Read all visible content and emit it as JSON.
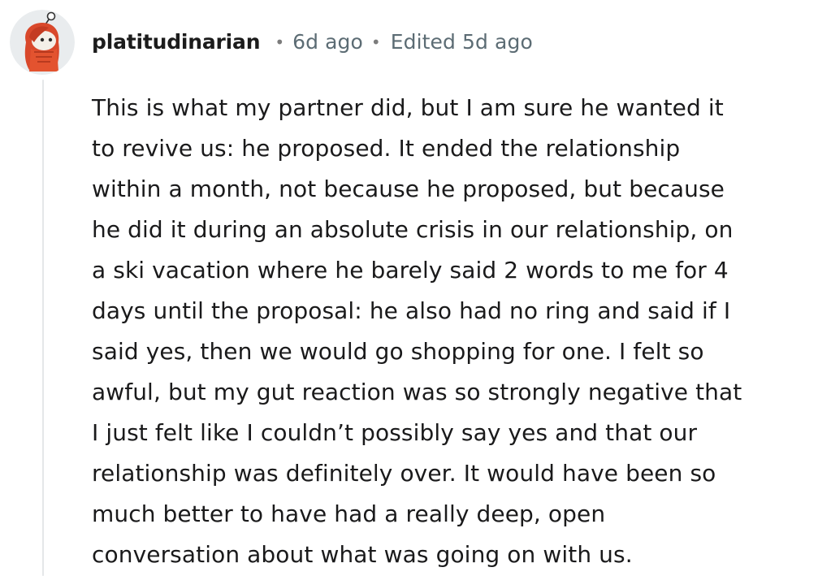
{
  "comment": {
    "author": {
      "username": "platitudinarian",
      "avatar_icon": "snoo-avatar-icon"
    },
    "separator": "•",
    "posted": "6d ago",
    "edited": "Edited 5d ago",
    "body_lines": [
      "This is what my partner did, but I am sure he wanted it",
      "to revive us: he proposed. It ended the relationship",
      "within a month, not because he proposed, but because",
      "he did it during an absolute crisis in our relationship, on",
      "a ski vacation where he barely said 2 words to me for 4",
      "days until the proposal: he also had no ring and said if I",
      "said yes, then we would go shopping for one. I felt so",
      "awful, but my gut reaction was so strongly negative that",
      "I just felt like I couldn’t possibly say yes and that our",
      "relationship was definitely over. It would have been so",
      "much better to have had a really deep, open",
      "conversation about what was going on with us."
    ]
  },
  "colors": {
    "username": "#1c1c1c",
    "meta": "#5c6c74",
    "body": "#1a1a1b",
    "thread_line": "#e5e7e9",
    "avatar_bg": "#e9ecee",
    "avatar_hair": "#d9482b",
    "avatar_skin": "#f4efe8"
  }
}
